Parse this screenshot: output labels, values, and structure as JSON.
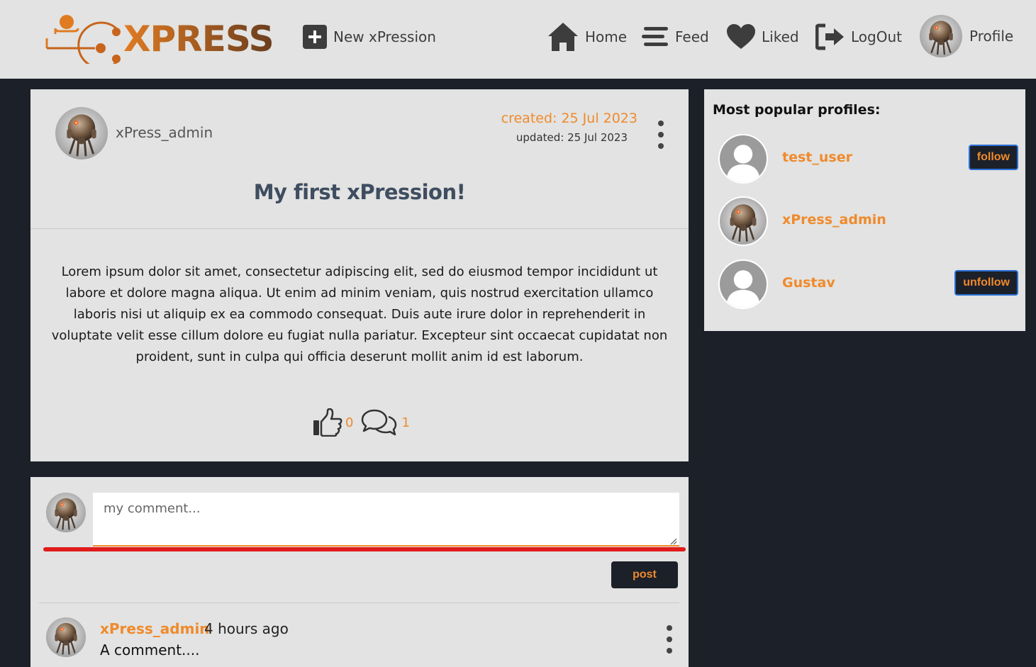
{
  "nav": {
    "logo_text": "XPRESS",
    "new_label": "New xPression",
    "home_label": "Home",
    "feed_label": "Feed",
    "liked_label": "Liked",
    "logout_label": "LogOut",
    "profile_label": "Profile",
    "icons": [
      "plus-square-icon",
      "home-icon",
      "feed-icon",
      "heart-icon",
      "logout-icon"
    ]
  },
  "post": {
    "author": "xPress_admin",
    "created": "created: 25 Jul 2023",
    "updated": "updated: 25 Jul 2023",
    "title": "My first xPression!",
    "body": "Lorem ipsum dolor sit amet, consectetur adipiscing elit, sed do eiusmod tempor incididunt ut labore et dolore magna aliqua. Ut enim ad minim veniam, quis nostrud exercitation ullamco laboris nisi ut aliquip ex ea commodo consequat. Duis aute irure dolor in reprehenderit in voluptate velit esse cillum dolore eu fugiat nulla pariatur. Excepteur sint occaecat cupidatat non proident, sunt in culpa qui officia deserunt mollit anim id est laborum.",
    "likes": "0",
    "comments": "1"
  },
  "popular": {
    "title": "Most popular profiles:",
    "profiles": [
      {
        "name": "test_user",
        "button": "follow"
      },
      {
        "name": "xPress_admin",
        "button": ""
      },
      {
        "name": "Gustav",
        "button": "unfollow"
      }
    ]
  },
  "comment_form": {
    "placeholder": "my comment...",
    "post_label": "post"
  },
  "comments": [
    {
      "author": "xPress_admin",
      "time": "4 hours ago",
      "text": "A comment...."
    }
  ],
  "colors": {
    "accent": "#f08a2c",
    "dark": "#1c2029",
    "card": "#e2e3e2",
    "title": "#3f4d60"
  }
}
